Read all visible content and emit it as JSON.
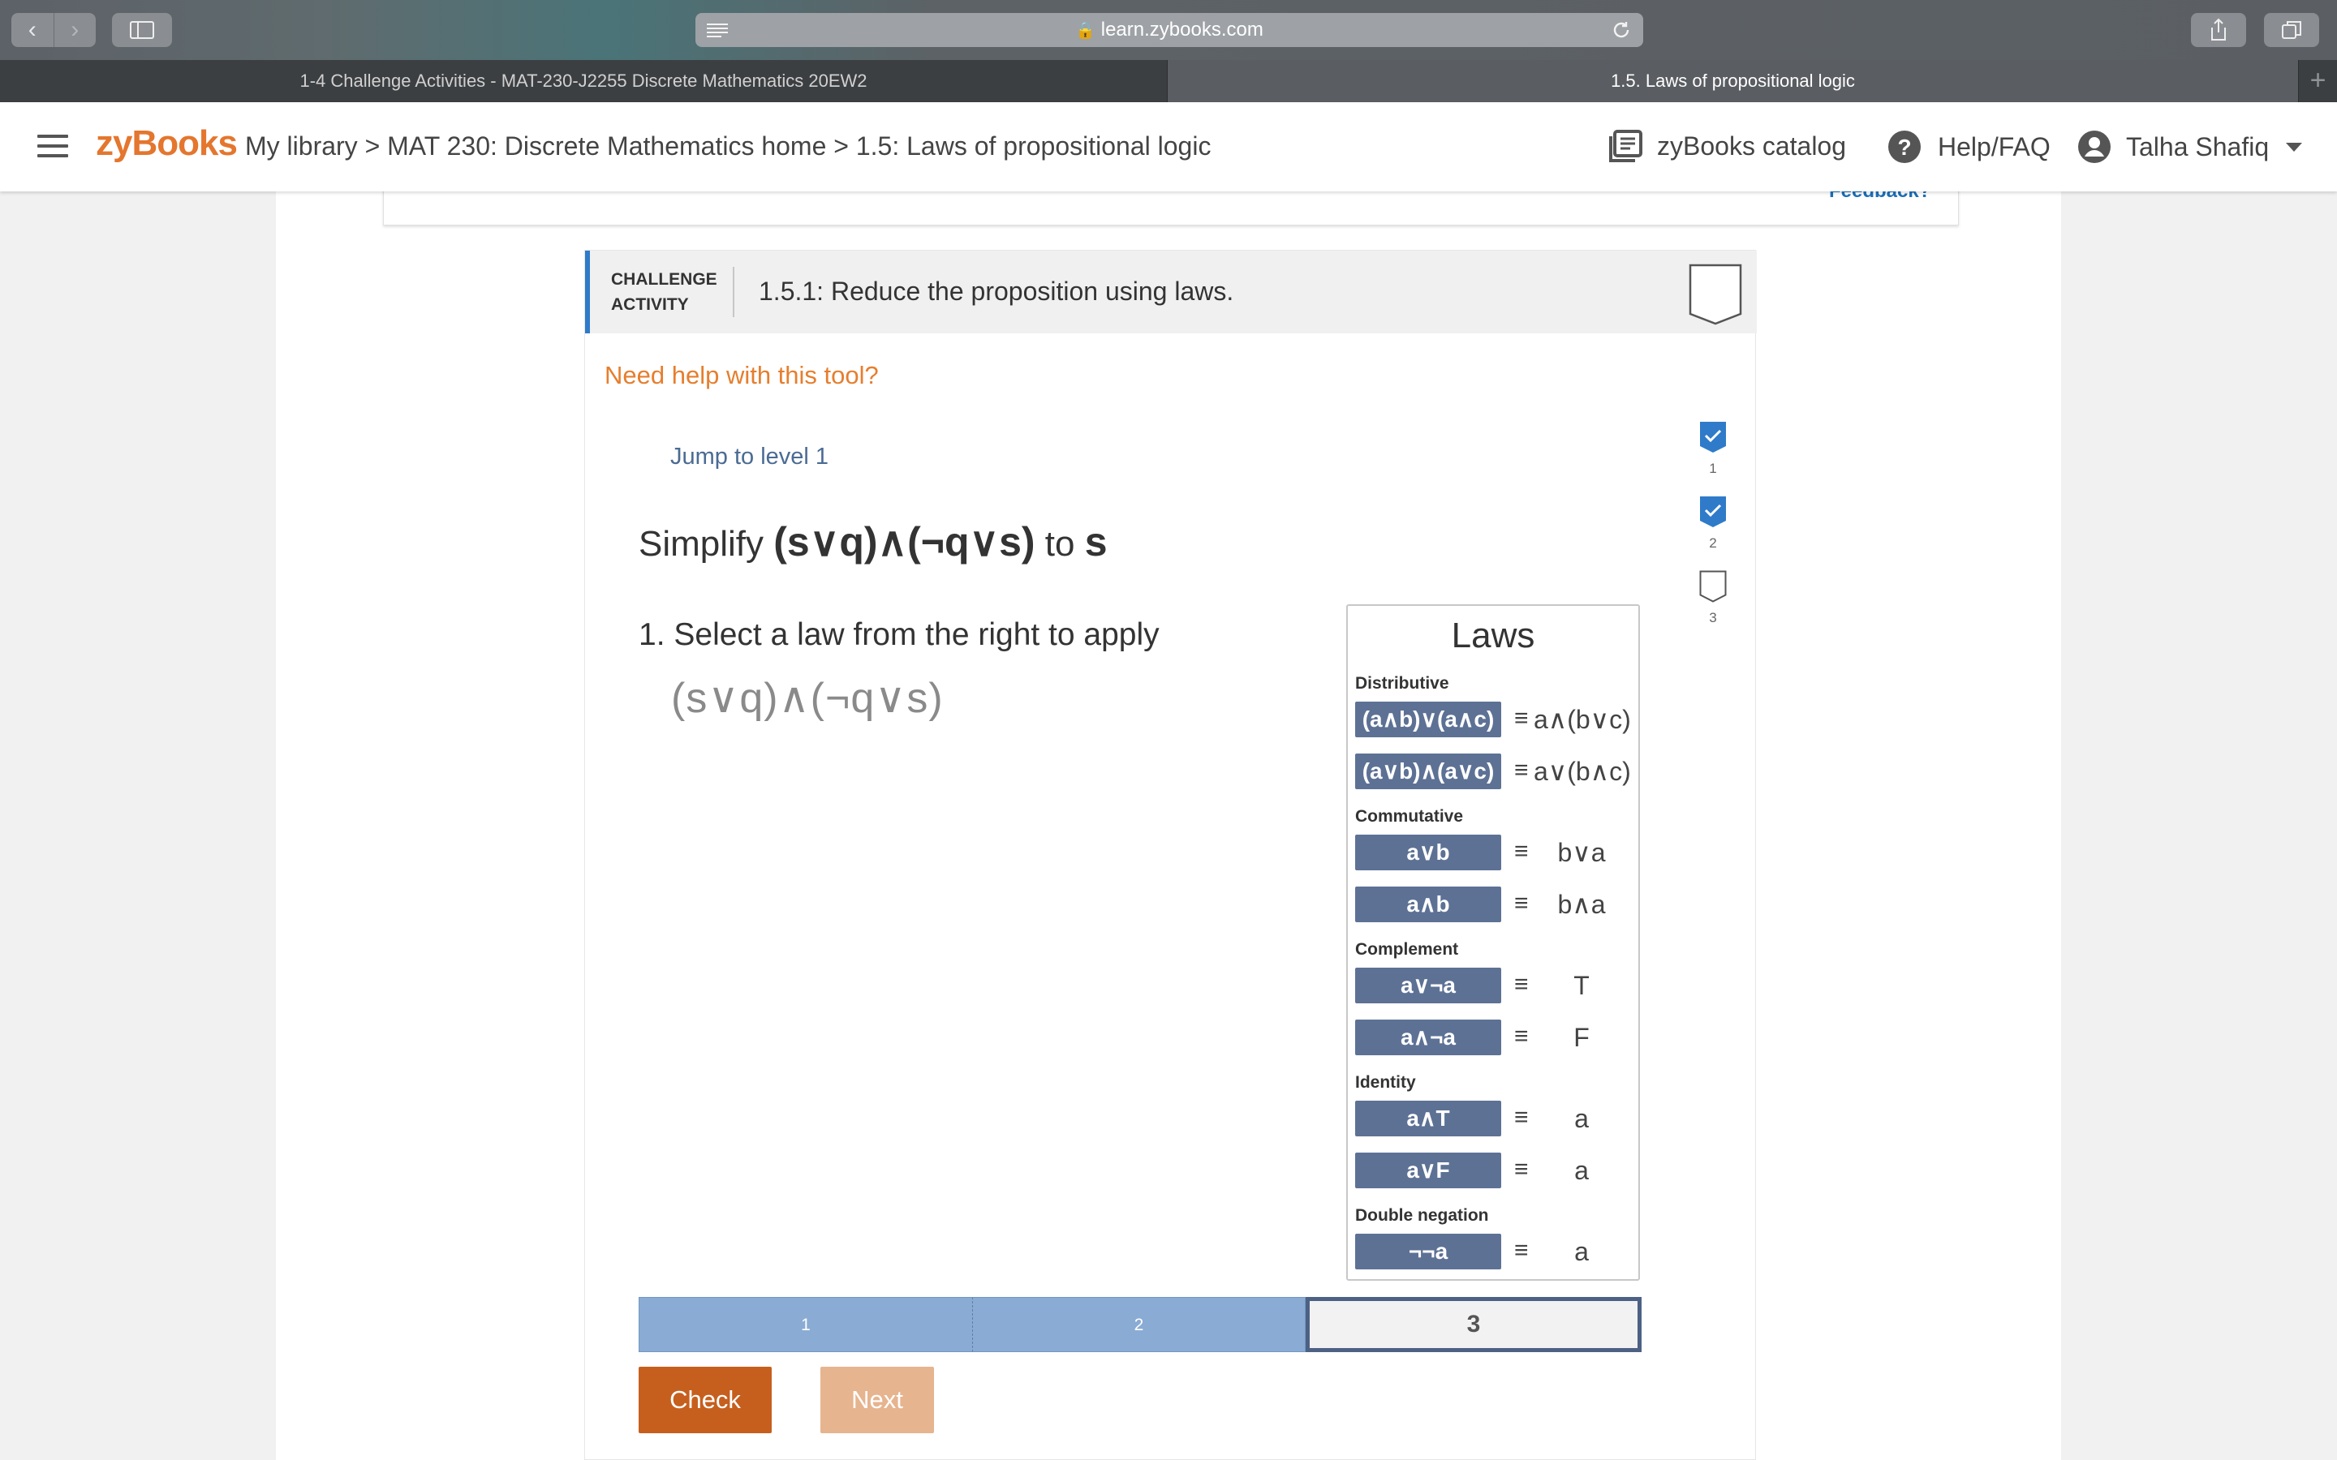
{
  "browser": {
    "url": "learn.zybooks.com",
    "tabs": [
      {
        "title": "1-4 Challenge Activities - MAT-230-J2255 Discrete Mathematics 20EW2",
        "active": false
      },
      {
        "title": "1.5. Laws of propositional logic",
        "active": true
      }
    ],
    "new_tab": "+"
  },
  "header": {
    "logo": "zyBooks",
    "breadcrumb": "My library > MAT 230: Discrete Mathematics home > 1.5: Laws of propositional logic",
    "catalog": "zyBooks catalog",
    "help": "Help/FAQ",
    "user": "Talha Shafiq"
  },
  "prev_section": {
    "feedback": "Feedback?"
  },
  "activity": {
    "type": "CHALLENGE ACTIVITY",
    "title": "1.5.1: Reduce the proposition using laws.",
    "help_link": "Need help with this tool?",
    "jump": "Jump to level 1",
    "problem_prefix": "Simplify",
    "problem_expr": "(s∨q)∧(¬q∨s)",
    "problem_to": "to",
    "problem_target": "s",
    "step": "1. Select a law from the right to apply",
    "current_expr": "(s∨q)∧(¬q∨s)",
    "levels": [
      {
        "num": "1",
        "done": true
      },
      {
        "num": "2",
        "done": true
      },
      {
        "num": "3",
        "done": false
      }
    ]
  },
  "laws": {
    "title": "Laws",
    "equiv": "≡",
    "categories": [
      {
        "name": "Distributive",
        "rows": [
          {
            "lhs": "(a∧b)∨(a∧c)",
            "rhs": "a∧(b∨c)"
          },
          {
            "lhs": "(a∨b)∧(a∨c)",
            "rhs": "a∨(b∧c)"
          }
        ]
      },
      {
        "name": "Commutative",
        "rows": [
          {
            "lhs": "a∨b",
            "rhs": "b∨a"
          },
          {
            "lhs": "a∧b",
            "rhs": "b∧a"
          }
        ]
      },
      {
        "name": "Complement",
        "rows": [
          {
            "lhs": "a∨¬a",
            "rhs": "T"
          },
          {
            "lhs": "a∧¬a",
            "rhs": "F"
          }
        ]
      },
      {
        "name": "Identity",
        "rows": [
          {
            "lhs": "a∧T",
            "rhs": "a"
          },
          {
            "lhs": "a∨F",
            "rhs": "a"
          }
        ]
      },
      {
        "name": "Double negation",
        "rows": [
          {
            "lhs": "¬¬a",
            "rhs": "a"
          }
        ]
      }
    ]
  },
  "progress": {
    "segments": [
      "1",
      "2",
      "3"
    ],
    "current": 3
  },
  "buttons": {
    "check": "Check",
    "next": "Next"
  },
  "colors": {
    "brand": "#e4762e",
    "accent_blue": "#2f7bc9",
    "law_button": "#5d7195",
    "check": "#c65f1e"
  }
}
